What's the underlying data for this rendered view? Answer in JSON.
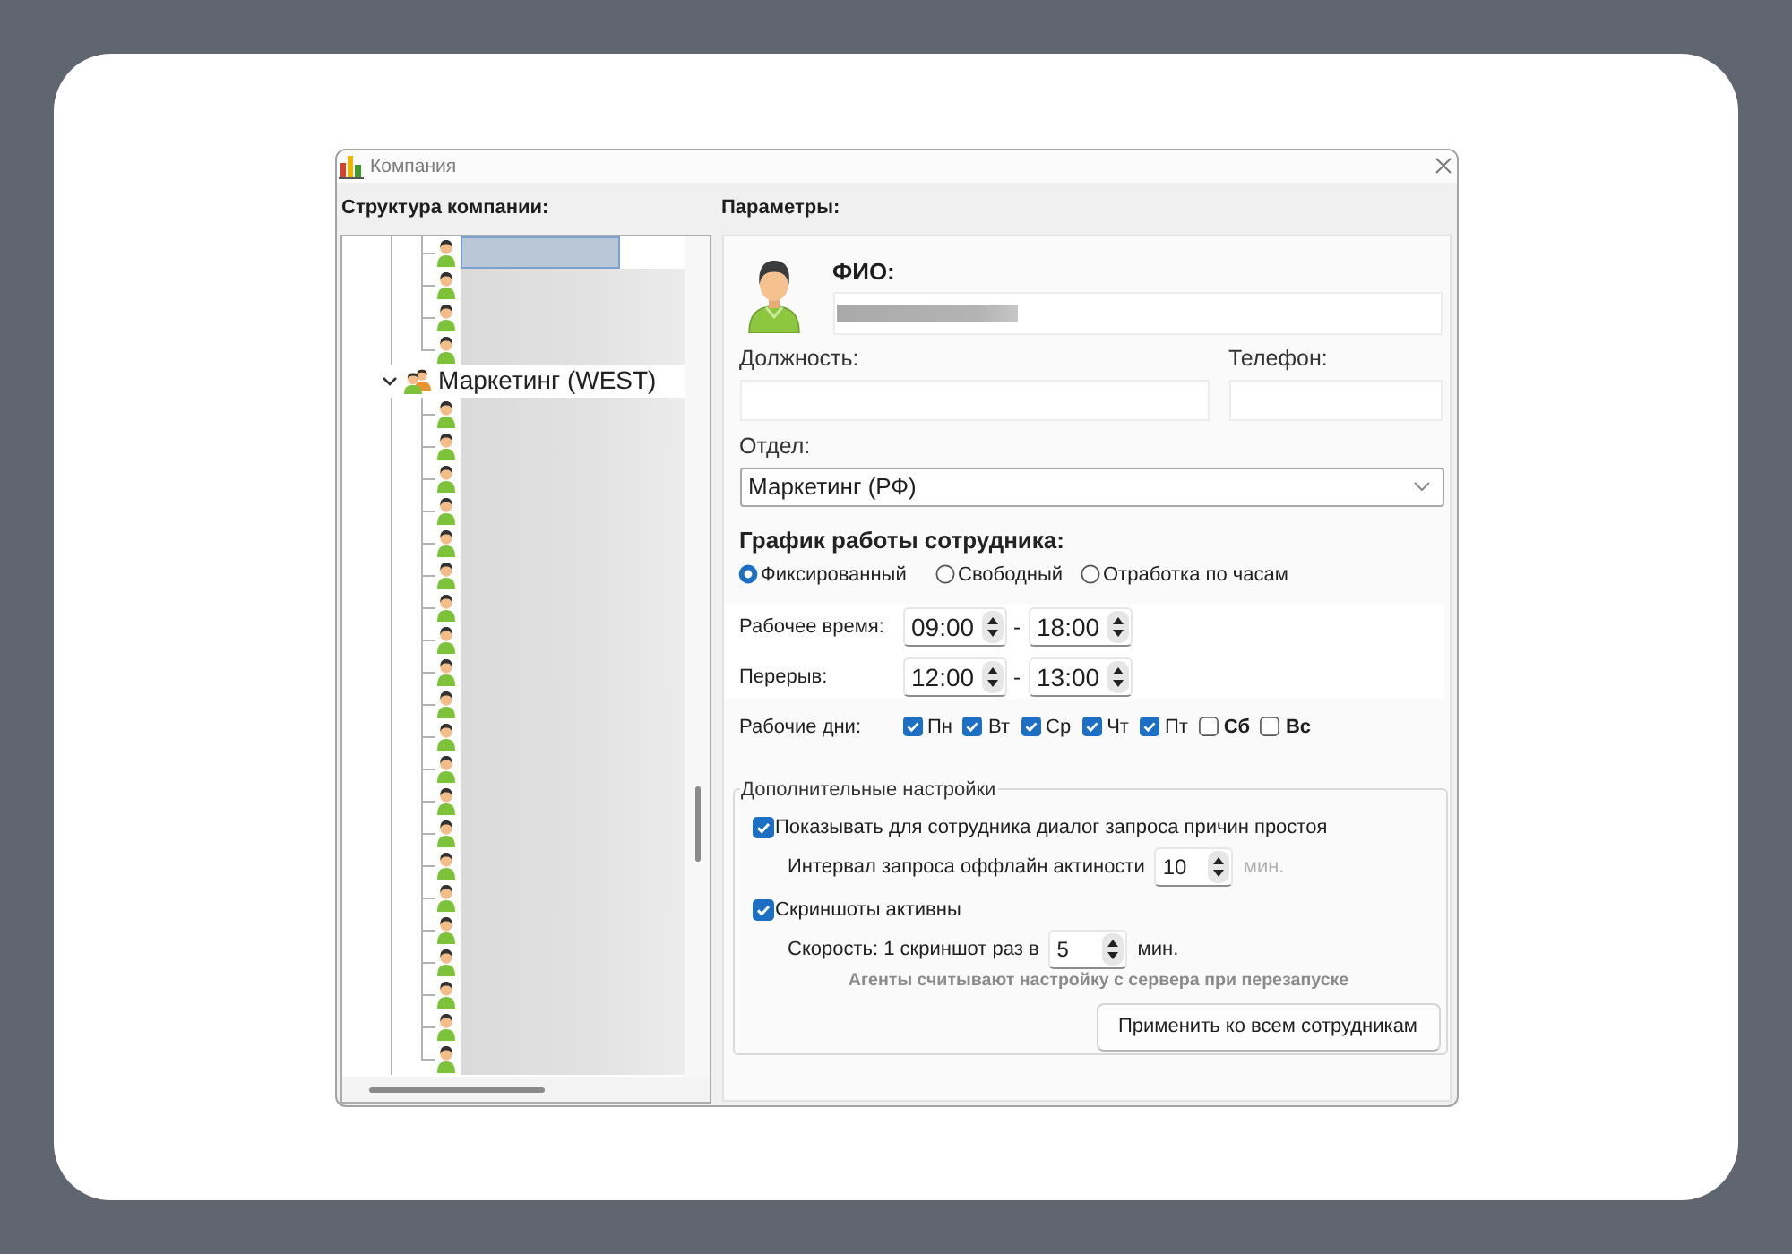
{
  "window": {
    "title": "Компания"
  },
  "structure": {
    "heading": "Структура компании:",
    "tree": [
      {
        "kind": "department",
        "expanded": true,
        "children": [
          {
            "kind": "employee",
            "redacted": true,
            "selected": true
          },
          {
            "kind": "employee",
            "redacted": true,
            "selected": false
          },
          {
            "kind": "employee",
            "redacted": true,
            "selected": false
          },
          {
            "kind": "employee",
            "redacted": true,
            "selected": false
          }
        ]
      },
      {
        "kind": "department",
        "label": "Маркетинг (WEST)",
        "expanded": true,
        "selected": false,
        "children": [
          {
            "kind": "employee",
            "redacted": true,
            "selected": false
          },
          {
            "kind": "employee",
            "redacted": true,
            "selected": false
          },
          {
            "kind": "employee",
            "redacted": true,
            "selected": false
          },
          {
            "kind": "employee",
            "redacted": true,
            "selected": false
          },
          {
            "kind": "employee",
            "redacted": true,
            "selected": false
          },
          {
            "kind": "employee",
            "redacted": true,
            "selected": false
          },
          {
            "kind": "employee",
            "redacted": true,
            "selected": false
          },
          {
            "kind": "employee",
            "redacted": true,
            "selected": false
          },
          {
            "kind": "employee",
            "redacted": true,
            "selected": false
          },
          {
            "kind": "employee",
            "redacted": true,
            "selected": false
          },
          {
            "kind": "employee",
            "redacted": true,
            "selected": false
          },
          {
            "kind": "employee",
            "redacted": true,
            "selected": false
          },
          {
            "kind": "employee",
            "redacted": true,
            "selected": false
          },
          {
            "kind": "employee",
            "redacted": true,
            "selected": false
          },
          {
            "kind": "employee",
            "redacted": true,
            "selected": false
          },
          {
            "kind": "employee",
            "redacted": true,
            "selected": false
          },
          {
            "kind": "employee",
            "redacted": true,
            "selected": false
          },
          {
            "kind": "employee",
            "redacted": true,
            "selected": false
          },
          {
            "kind": "employee",
            "redacted": true,
            "selected": false
          },
          {
            "kind": "employee",
            "redacted": true,
            "selected": false
          },
          {
            "kind": "employee",
            "redacted": true,
            "selected": false
          }
        ]
      }
    ]
  },
  "parameters": {
    "heading": "Параметры:",
    "full_name": {
      "label": "ФИО:",
      "redacted": true
    },
    "position": {
      "label": "Должность:"
    },
    "phone": {
      "label": "Телефон:"
    },
    "department": {
      "label": "Отдел:",
      "value": "Маркетинг (РФ)"
    },
    "schedule": {
      "heading": "График работы сотрудника:",
      "modes": [
        {
          "label": "Фиксированный",
          "selected": true
        },
        {
          "label": "Свободный",
          "selected": false
        },
        {
          "label": "Отработка по часам",
          "selected": false
        }
      ],
      "times": [
        {
          "label": "Рабочее время:",
          "from": "09:00",
          "separator": "-",
          "to": "18:00"
        },
        {
          "label": "Перерыв:",
          "from": "12:00",
          "separator": "-",
          "to": "13:00"
        }
      ],
      "work_days": {
        "label": "Рабочие дни:",
        "days": [
          {
            "label": "Пн",
            "kind": "weekday",
            "checked": true
          },
          {
            "label": "Вт",
            "kind": "weekday",
            "checked": true
          },
          {
            "label": "Ср",
            "kind": "weekday",
            "checked": true
          },
          {
            "label": "Чт",
            "kind": "weekday",
            "checked": true
          },
          {
            "label": "Пт",
            "kind": "weekday",
            "checked": true
          },
          {
            "label": "Сб",
            "kind": "weekend",
            "checked": false
          },
          {
            "label": "Вс",
            "kind": "weekend",
            "checked": false
          }
        ]
      }
    },
    "extra": {
      "title": "Дополнительные настройки",
      "items": [
        {
          "kind": "checkbox",
          "label": "Показывать для сотрудника диалог запроса причин простоя",
          "checked": true
        },
        {
          "kind": "spinner",
          "label": "Интервал запроса оффлайн актиности",
          "value": "10",
          "unit": "мин.",
          "unit_disabled": true
        },
        {
          "kind": "checkbox",
          "label": "Скриншоты активны",
          "checked": true
        },
        {
          "kind": "spinner",
          "label": "Скорость: 1 скриншот раз в",
          "value": "5",
          "unit": "мин.",
          "unit_disabled": false
        }
      ],
      "note": "Агенты считывают настройку с сервера при перезапуске",
      "button": "Применить ко всем сотрудникам"
    }
  }
}
